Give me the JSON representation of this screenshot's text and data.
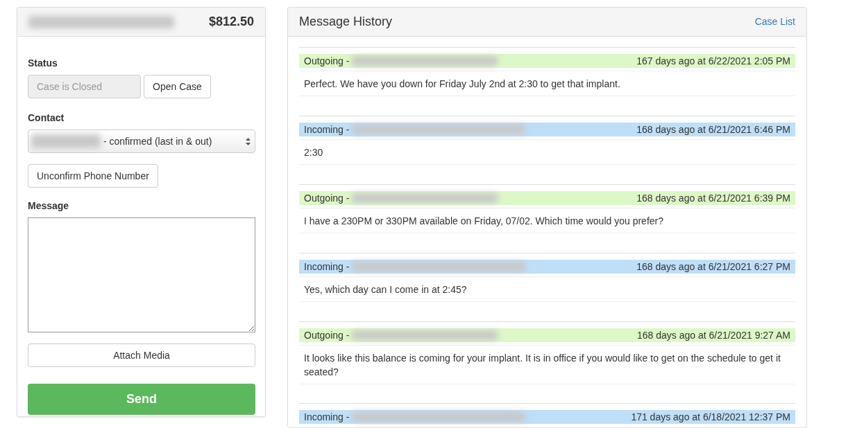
{
  "case_panel": {
    "amount": "$812.50",
    "status_label": "Status",
    "status_value": "Case is Closed",
    "open_case_button": "Open Case",
    "contact_label": "Contact",
    "contact_value": "- confirmed (last in & out)",
    "unconfirm_button": "Unconfirm Phone Number",
    "message_label": "Message",
    "attach_button": "Attach Media",
    "send_button": "Send"
  },
  "history": {
    "title": "Message History",
    "case_list_link": "Case List",
    "messages": [
      {
        "kind": "outgoing",
        "label": "Outgoing -",
        "time": "167 days ago at 6/22/2021 2:05 PM",
        "text": "Perfect. We have you down for Friday July 2nd at 2:30 to get that implant."
      },
      {
        "kind": "incoming",
        "label": "Incoming -",
        "time": "168 days ago at 6/21/2021 6:46 PM",
        "text": "2:30"
      },
      {
        "kind": "outgoing",
        "label": "Outgoing -",
        "time": "168 days ago at 6/21/2021 6:39 PM",
        "text": "I have a 230PM or 330PM available on Friday, 07/02. Which time would you prefer?"
      },
      {
        "kind": "incoming",
        "label": "Incoming -",
        "time": "168 days ago at 6/21/2021 6:27 PM",
        "text": "Yes, which day can I come in at 2:45?"
      },
      {
        "kind": "outgoing",
        "label": "Outgoing -",
        "time": "168 days ago at 6/21/2021 9:27 AM",
        "text": "It looks like this balance is coming for your implant. It is in office if you would like to get on the schedule to get it seated?"
      },
      {
        "kind": "incoming",
        "label": "Incoming -",
        "time": "171 days ago at 6/18/2021 12:37 PM"
      }
    ]
  }
}
